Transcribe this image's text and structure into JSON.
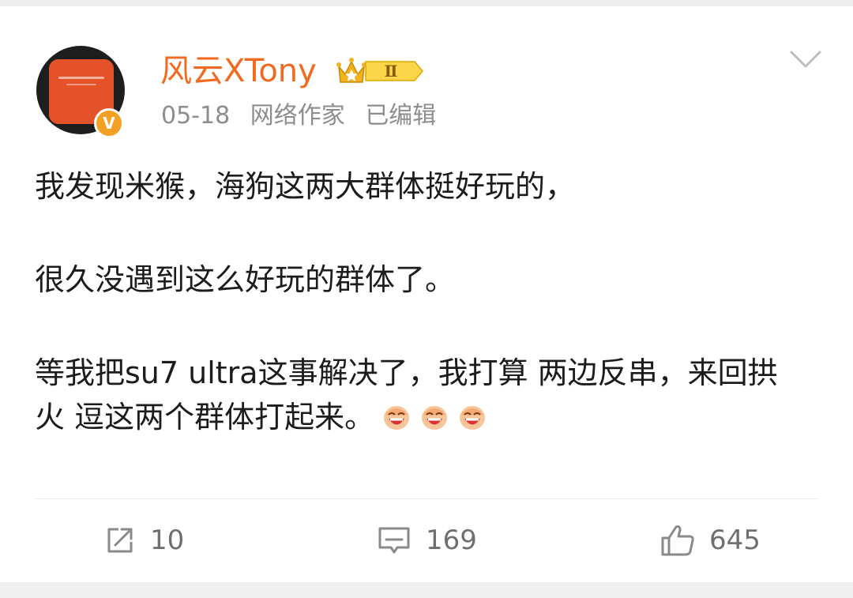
{
  "post": {
    "author": {
      "name": "风云XTony",
      "vip_level": "Ⅱ",
      "verified_mark": "V",
      "avatar": "orange-card-avatar",
      "badge_color": "#f3a024",
      "name_color": "#f06a22"
    },
    "meta": {
      "date": "05-18",
      "role": "网络作家",
      "status": "已编辑"
    },
    "content": {
      "paragraphs": [
        "我发现米猴，海狗这两大群体挺好玩的，",
        "很久没遇到这么好玩的群体了。",
        "等我把su7 ultra这事解决了，我打算 两边反串，来回拱火 逗这两个群体打起来。"
      ],
      "emojis": [
        "laughing-emoji",
        "laughing-emoji",
        "laughing-emoji"
      ]
    },
    "actions": {
      "forward": {
        "icon": "share-icon",
        "count": "10"
      },
      "comment": {
        "icon": "comment-icon",
        "count": "169"
      },
      "like": {
        "icon": "thumbs-up-icon",
        "count": "645"
      }
    },
    "menu_icon": "chevron-down-icon"
  }
}
